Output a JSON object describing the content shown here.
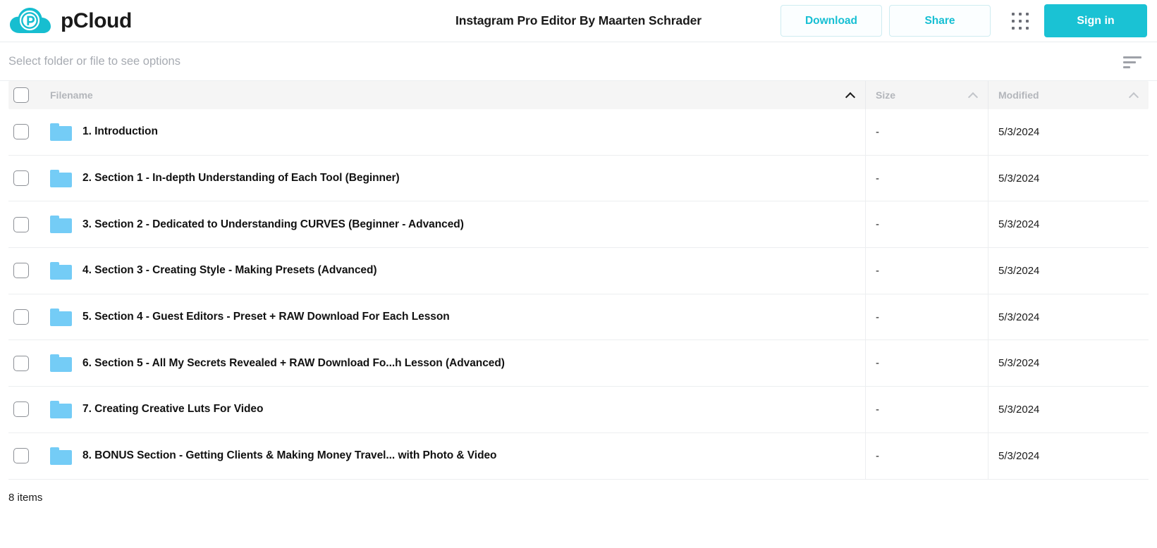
{
  "header": {
    "brand_name": "pCloud",
    "logo_icon": "pcloud-cloud-logo",
    "title": "Instagram Pro Editor By Maarten Schrader",
    "download_label": "Download",
    "share_label": "Share",
    "grid_icon": "apps-grid-icon",
    "signin_label": "Sign in",
    "accent_color": "#1ac2d4",
    "outline_border_color": "#cfecf1"
  },
  "toolbar": {
    "hint": "Select folder or file to see options",
    "sort_icon": "sort-lines-icon"
  },
  "table": {
    "columns": {
      "filename": "Filename",
      "size": "Size",
      "modified": "Modified"
    },
    "sort": {
      "filename_chevron": "chevron-up-icon",
      "size_chevron": "chevron-up-icon",
      "modified_chevron": "chevron-up-icon"
    },
    "rows": [
      {
        "name": "1. Introduction",
        "size": "-",
        "modified": "5/3/2024",
        "icon": "folder-icon"
      },
      {
        "name": "2. Section 1 - In-depth Understanding of Each Tool (Beginner)",
        "size": "-",
        "modified": "5/3/2024",
        "icon": "folder-icon"
      },
      {
        "name": "3. Section 2 - Dedicated to Understanding CURVES (Beginner - Advanced)",
        "size": "-",
        "modified": "5/3/2024",
        "icon": "folder-icon"
      },
      {
        "name": "4. Section 3 - Creating Style - Making Presets (Advanced)",
        "size": "-",
        "modified": "5/3/2024",
        "icon": "folder-icon"
      },
      {
        "name": "5. Section 4 - Guest Editors - Preset + RAW Download For Each Lesson",
        "size": "-",
        "modified": "5/3/2024",
        "icon": "folder-icon"
      },
      {
        "name": "6. Section 5 - All My Secrets Revealed + RAW Download Fo...h Lesson (Advanced)",
        "size": "-",
        "modified": "5/3/2024",
        "icon": "folder-icon"
      },
      {
        "name": "7. Creating Creative Luts For Video",
        "size": "-",
        "modified": "5/3/2024",
        "icon": "folder-icon"
      },
      {
        "name": "8. BONUS Section - Getting Clients & Making Money Travel... with Photo & Video",
        "size": "-",
        "modified": "5/3/2024",
        "icon": "folder-icon"
      }
    ]
  },
  "footer": {
    "item_count": "8 items"
  }
}
